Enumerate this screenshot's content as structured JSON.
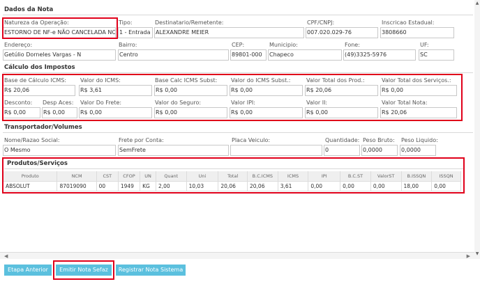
{
  "dados_nota": {
    "title": "Dados da Nota",
    "natureza": {
      "label": "Natureza da Operação:",
      "value": "ESTORNO DE NF-e NÃO CANCELADA NO PI"
    },
    "tipo": {
      "label": "Tipo:",
      "value": "1 - Entrada"
    },
    "destinatario": {
      "label": "Destinatario/Remetente:",
      "value": "ALEXANDRE MEIER"
    },
    "cpf": {
      "label": "CPF/CNPJ:",
      "value": "007.020.029-76"
    },
    "inscricao": {
      "label": "Inscricao Estadual:",
      "value": "3808660"
    },
    "endereco": {
      "label": "Endereço:",
      "value": "Getúlio Dorneles Vargas - N"
    },
    "bairro": {
      "label": "Bairro:",
      "value": "Centro"
    },
    "cep": {
      "label": "CEP:",
      "value": "89801-000"
    },
    "municipio": {
      "label": "Municipio:",
      "value": "Chapeco"
    },
    "fone": {
      "label": "Fone:",
      "value": "(49)3325-5976"
    },
    "uf": {
      "label": "UF:",
      "value": "SC"
    }
  },
  "calculo": {
    "title": "Cálculo dos Impostos",
    "base_icms": {
      "label": "Base de Cálculo ICMS:",
      "value": "R$ 20,06"
    },
    "valor_icms": {
      "label": "Valor do ICMS:",
      "value": "R$ 3,61"
    },
    "base_subst": {
      "label": "Base Calc ICMS Subst:",
      "value": "R$ 0,00"
    },
    "valor_subst": {
      "label": "Valor do ICMS Subst.:",
      "value": "R$ 0,00"
    },
    "valor_prod": {
      "label": "Valor Total dos Prod.:",
      "value": "R$ 20,06"
    },
    "valor_serv": {
      "label": "Valor Total dos Serviços.:",
      "value": "R$ 0,00"
    },
    "desconto": {
      "label": "Desconto:",
      "value": "R$ 0,00"
    },
    "desp": {
      "label": "Desp Aces:",
      "value": "R$ 0,00"
    },
    "frete": {
      "label": "Valor Do Frete:",
      "value": "R$ 0,00"
    },
    "seguro": {
      "label": "Valor do Seguro:",
      "value": "R$ 0,00"
    },
    "ipi": {
      "label": "Valor IPI:",
      "value": "R$ 0,00"
    },
    "ii": {
      "label": "Valor II:",
      "value": "R$ 0,00"
    },
    "total": {
      "label": "Valor Total Nota:",
      "value": "R$ 20,06"
    }
  },
  "transportador": {
    "title": "Transportador/Volumes",
    "nome": {
      "label": "Nome/Razao Social:",
      "value": "O Mesmo"
    },
    "frete": {
      "label": "Frete por Conta:",
      "value": "SemFrete"
    },
    "placa": {
      "label": "Placa Veiculo:",
      "value": ""
    },
    "quantidade": {
      "label": "Quantidade:",
      "value": "0"
    },
    "peso_bruto": {
      "label": "Peso Bruto:",
      "value": "0,0000"
    },
    "peso_liquido": {
      "label": "Peso Liquido:",
      "value": "0,0000"
    }
  },
  "produtos": {
    "title": "Produtos/Serviços",
    "columns": [
      "Produto",
      "NCM",
      "CST",
      "CFOP",
      "UN",
      "Quant",
      "Uni",
      "Total",
      "B.C.ICMS",
      "ICMS",
      "IPI",
      "B.C.ST",
      "ValorST",
      "B.ISSQN",
      "ISSQN"
    ],
    "rows": [
      [
        "ABSOLUT",
        "87019090",
        "00",
        "1949",
        "KG",
        "2,00",
        "10,03",
        "20,06",
        "20,06",
        "3,61",
        "0,00",
        "0,00",
        "0,00",
        "18,00",
        "0,00"
      ]
    ]
  },
  "buttons": {
    "anterior": "Etapa Anterior",
    "emitir": "Emitir Nota Sefaz",
    "registrar": "Registrar Nota Sistema"
  }
}
